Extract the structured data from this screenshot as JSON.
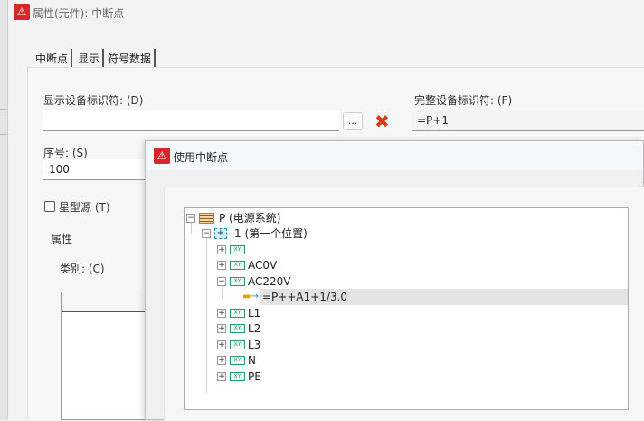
{
  "main_window": {
    "title": "属性(元件): 中断点",
    "icon": "app-warning-logo-icon",
    "tabs": [
      {
        "label": "中断点",
        "active": true
      },
      {
        "label": "显示"
      },
      {
        "label": "符号数据"
      }
    ],
    "display_id_label": "显示设备标识符: (D)",
    "display_id_value": "",
    "browse_label": "...",
    "full_id_label": "完整设备标识符: (F)",
    "full_id_value": "=P+1",
    "seq_label": "序号: (S)",
    "seq_value": "100",
    "star_source_label": "星型源 (T)",
    "star_source_checked": false,
    "properties_group": "属性",
    "category_label": "类别: (C)"
  },
  "dialog": {
    "title": "使用中断点",
    "icon": "app-warning-logo-icon",
    "tree": [
      {
        "label": "P (电源系统)",
        "level": 0,
        "expanded": true,
        "icon": "structure-icon"
      },
      {
        "label": "1 (第一个位置)",
        "level": 1,
        "expanded": true,
        "icon": "location-icon"
      },
      {
        "label": "",
        "level": 2,
        "expanded": false,
        "icon": "xy-icon"
      },
      {
        "label": "AC0V",
        "level": 2,
        "expanded": false,
        "icon": "xy-icon"
      },
      {
        "label": "AC220V",
        "level": 2,
        "expanded": true,
        "icon": "xy-icon"
      },
      {
        "label": "=P++A1+1/3.0",
        "level": 3,
        "selected": true,
        "icon": "interruption-point-icon"
      },
      {
        "label": "L1",
        "level": 2,
        "expanded": false,
        "icon": "xy-icon"
      },
      {
        "label": "L2",
        "level": 2,
        "expanded": false,
        "icon": "xy-icon"
      },
      {
        "label": "L3",
        "level": 2,
        "expanded": false,
        "icon": "xy-icon"
      },
      {
        "label": "N",
        "level": 2,
        "expanded": false,
        "icon": "xy-icon"
      },
      {
        "label": "PE",
        "level": 2,
        "expanded": false,
        "icon": "xy-icon"
      }
    ]
  }
}
